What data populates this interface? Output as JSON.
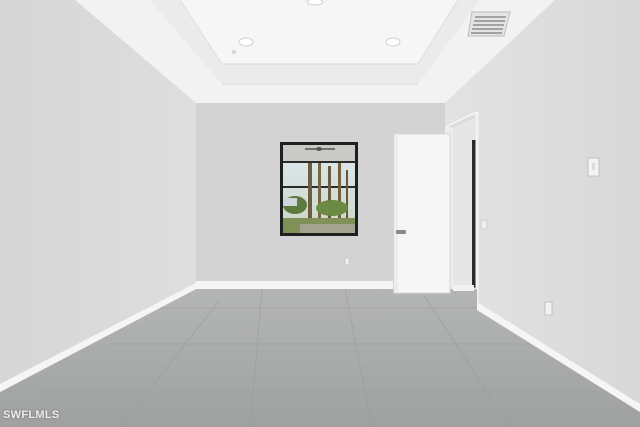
{
  "image": {
    "subject": "empty-room-interior",
    "watermark": "SWFLMLS"
  },
  "colors": {
    "wall_left": "#d9d9d9",
    "wall_back": "#d4d4d4",
    "wall_right": "#dadada",
    "ceiling": "#f3f3f3",
    "tray_ceiling": "#eeeeee",
    "floor": "#a9abab",
    "baseboard": "#f4f4f4",
    "door": "#f6f6f6",
    "window_frame": "#1f1f1f"
  }
}
